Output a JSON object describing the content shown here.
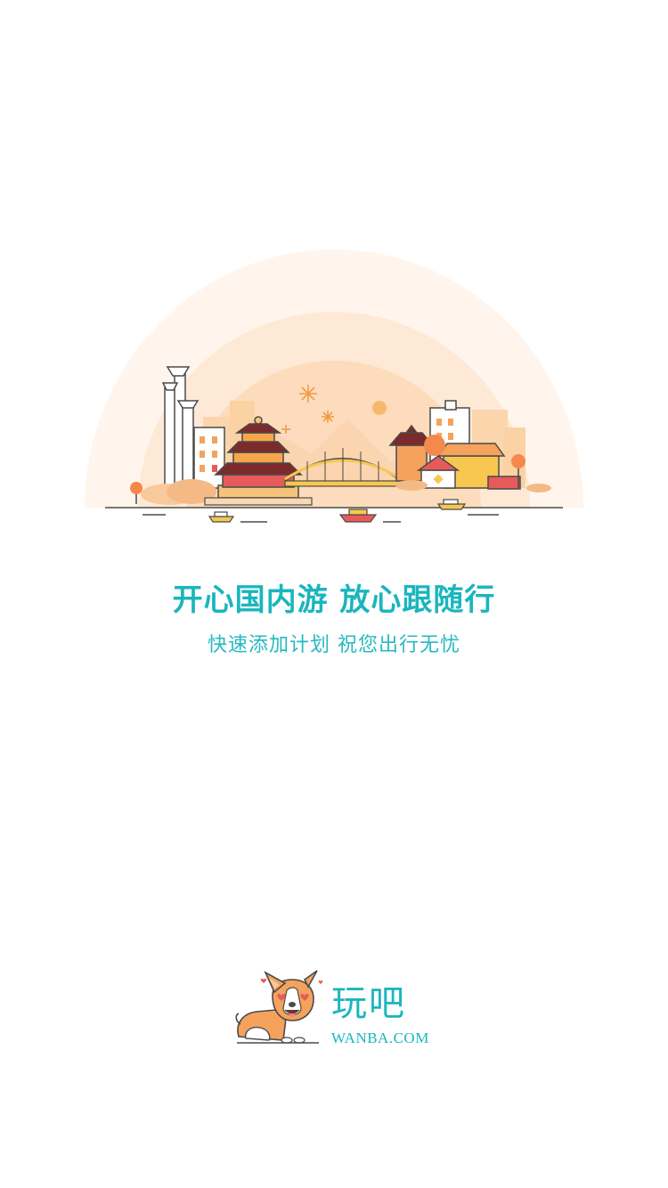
{
  "splash": {
    "headline": "开心国内游 放心跟随行",
    "subline": "快速添加计划 祝您出行无忧",
    "illustration_icon": "city-skyline-illustration",
    "colors": {
      "accent": "#1ab6bd",
      "warm_orange": "#f5a25d",
      "light_peach": "#fde9d6"
    }
  },
  "brand": {
    "mascot_icon": "corgi-dog-icon",
    "name": "玩吧",
    "domain": "WANBA.COM"
  }
}
